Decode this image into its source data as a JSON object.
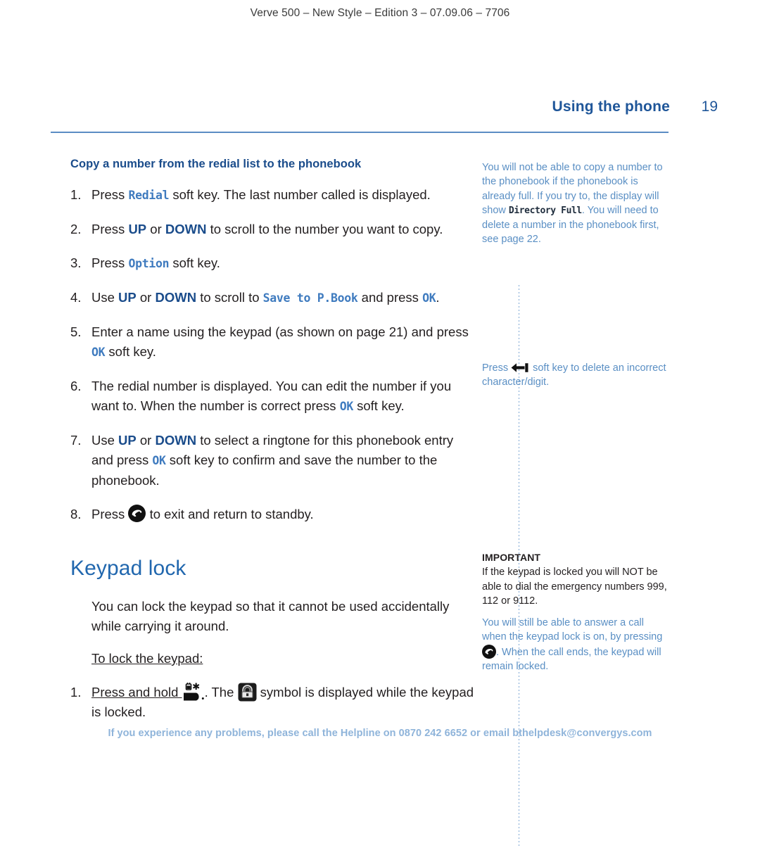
{
  "running_head": "Verve 500 – New Style – Edition 3 – 07.09.06 – 7706",
  "header": {
    "section_title": "Using the phone",
    "page_number": "19"
  },
  "main": {
    "sub_heading": "Copy a number from the redial list to the phonebook",
    "steps": [
      {
        "num": "1.",
        "pre": "Press ",
        "lcd": "Redial",
        "post": " soft key. The last number called is displayed."
      },
      {
        "num": "2.",
        "pre": "Press ",
        "key1": "UP",
        "mid": " or ",
        "key2": "DOWN",
        "post": " to scroll to the number you want to copy."
      },
      {
        "num": "3.",
        "pre": "Press ",
        "lcd": "Option",
        "post": " soft key."
      },
      {
        "num": "4.",
        "pre": "Use ",
        "key1": "UP",
        "mid": " or ",
        "key2": "DOWN",
        "mid2": " to scroll to ",
        "lcd": "Save to P.Book",
        "mid3": " and press ",
        "lcd2": "OK",
        "post": "."
      },
      {
        "num": "5.",
        "pre": "Enter a name using the keypad (as shown on page 21) and press ",
        "lcd": "OK",
        "post": " soft key."
      },
      {
        "num": "6.",
        "pre": "The redial number is displayed. You can edit the number if you want to. When the number is correct press ",
        "lcd": "OK",
        "post": " soft key."
      },
      {
        "num": "7.",
        "pre": "Use ",
        "key1": "UP",
        "mid": " or ",
        "key2": "DOWN",
        "mid2": " to select a ringtone for this phonebook entry and press ",
        "lcd": "OK",
        "post": " soft key to confirm and save the number to the phonebook."
      },
      {
        "num": "8.",
        "pre": "Press ",
        "icon": "end-call-icon",
        "post": " to exit and return to standby."
      }
    ],
    "keypad_lock": {
      "heading": "Keypad lock",
      "para1": "You can lock the keypad so that it cannot be used accidentally while carrying it around.",
      "para2": "To lock the keypad:",
      "step": {
        "num": "1.",
        "pre": "Press and hold ",
        "icon1": "star-key-lock-icon",
        "mid": ". The ",
        "icon2": "keypad-lock-symbol-icon",
        "post": " symbol is displayed while the keypad is locked."
      }
    }
  },
  "sidebar": {
    "note1": {
      "part1": "You will not be able to copy a number to the phonebook if the phonebook is already full. If you try to, the display will show ",
      "lcd": "Directory Full",
      "part2": ". You will need to delete a number in the phonebook first, see page 22."
    },
    "note2": {
      "part1": "Press ",
      "icon": "backspace-arrow-icon",
      "part2": " soft key to delete an incorrect character/digit."
    },
    "note3": {
      "title": "IMPORTANT",
      "body": "If the keypad is locked you will NOT be able to dial the emergency numbers 999, 112 or 9112."
    },
    "note4": {
      "part1": "You will still be able to answer a call when the keypad lock is on, by pressing ",
      "icon": "end-call-icon",
      "part2": ". When the call ends, the keypad will remain locked."
    }
  },
  "footer": "If you experience any problems, please call the Helpline on 0870 242 6652 or email bthelpdesk@convergys.com",
  "colors": {
    "heading_blue": "#1a4c8b",
    "title_blue": "#2167ae",
    "sidebar_blue": "#5a8fc4",
    "footer_blue": "#8fb4da",
    "rule_blue": "#5b8cc4",
    "body_black": "#231f20"
  }
}
